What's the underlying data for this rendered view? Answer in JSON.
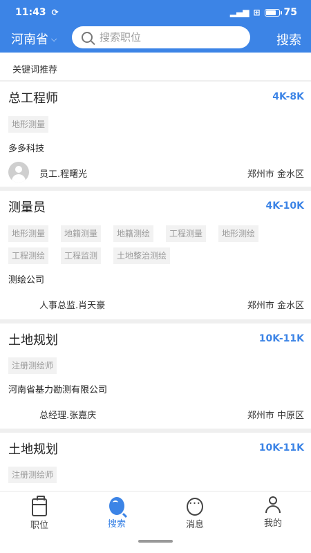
{
  "status_bar": {
    "time": "11:43",
    "battery": "75"
  },
  "header": {
    "province": "河南省",
    "search_placeholder": "搜索职位",
    "search_button": "搜索"
  },
  "keyword_recommend": "关键词推荐",
  "jobs": [
    {
      "title": "总工程师",
      "salary": "4K-8K",
      "tags": [
        "地形测量"
      ],
      "company": "多多科技",
      "contact": "员工.程曙光",
      "location": "郑州市 金水区"
    },
    {
      "title": "测量员",
      "salary": "4K-10K",
      "tags": [
        "地形测量",
        "地籍测量",
        "地籍测绘",
        "工程测量",
        "地形测绘",
        "工程测绘",
        "工程监测",
        "土地整治测绘"
      ],
      "company": "测绘公司",
      "contact": "人事总监.肖天豪",
      "location": "郑州市 金水区"
    },
    {
      "title": "土地规划",
      "salary": "10K-11K",
      "tags": [
        "注册测绘师"
      ],
      "company": "河南省基力勘测有限公司",
      "contact": "总经理.张嘉庆",
      "location": "郑州市 中原区"
    },
    {
      "title": "土地规划",
      "salary": "10K-11K",
      "tags": [
        "注册测绘师"
      ]
    }
  ],
  "bottom_nav": [
    {
      "label": "职位",
      "icon": "briefcase-icon"
    },
    {
      "label": "搜索",
      "icon": "search-icon",
      "active": true
    },
    {
      "label": "消息",
      "icon": "chat-icon"
    },
    {
      "label": "我的",
      "icon": "user-icon"
    }
  ],
  "colors": {
    "accent": "#3c84e6",
    "tag_bg": "#f2f2f2",
    "page_bg": "#efefef"
  }
}
